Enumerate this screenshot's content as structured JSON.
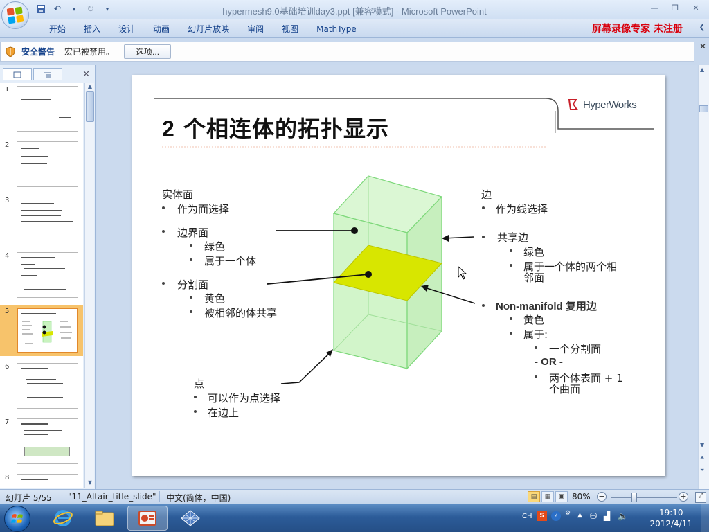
{
  "window": {
    "title": "hypermesh9.0基础培训day3.ppt [兼容模式] - Microsoft PowerPoint"
  },
  "ribbon": {
    "tabs": [
      "开始",
      "插入",
      "设计",
      "动画",
      "幻灯片放映",
      "审阅",
      "视图",
      "MathType"
    ],
    "recorder_text": "屏幕录像专家  未注册"
  },
  "security": {
    "title": "安全警告",
    "message": "宏已被禁用。",
    "options_button": "选项..."
  },
  "thumbnails": {
    "numbers": [
      "1",
      "2",
      "3",
      "4",
      "5",
      "6",
      "7",
      "8"
    ],
    "active_index": 5
  },
  "slide": {
    "title_num": "2",
    "title_text": " 个相连体的拓扑显示",
    "logo_text": "HyperWorks",
    "left": {
      "h1": "实体面",
      "l1": "作为面选择",
      "h2": "边界面",
      "l2a": "绿色",
      "l2b": "属于一个体",
      "h3": "分割面",
      "l3a": "黄色",
      "l3b": "被相邻的体共享",
      "h4": "点",
      "l4a": "可以作为点选择",
      "l4b": "在边上"
    },
    "right": {
      "h1": "边",
      "l1": "作为线选择",
      "h2": "共享边",
      "l2a": "绿色",
      "l2b_1": "属于一个体的两个相",
      "l2b_2": "邻面",
      "h3": "Non-manifold 复用边",
      "l3a": "黄色",
      "l3b": "属于:",
      "l3c": "一个分割面",
      "l3d": "- OR -",
      "l3e_1": "两个体表面 + 1",
      "l3e_2": "个曲面"
    },
    "bullet": "•",
    "colors": {
      "solid_face": "#c9f3bf",
      "solid_edge": "#7dd87a",
      "split_face": "#d8e600"
    }
  },
  "statusbar": {
    "slide_info": "幻灯片 5/55",
    "theme": "\"11_Altair_title_slide\"",
    "language": "中文(简体，中国)",
    "zoom": "80%"
  },
  "taskbar": {
    "ime": "CH",
    "time": "19:10",
    "date": "2012/4/11"
  }
}
